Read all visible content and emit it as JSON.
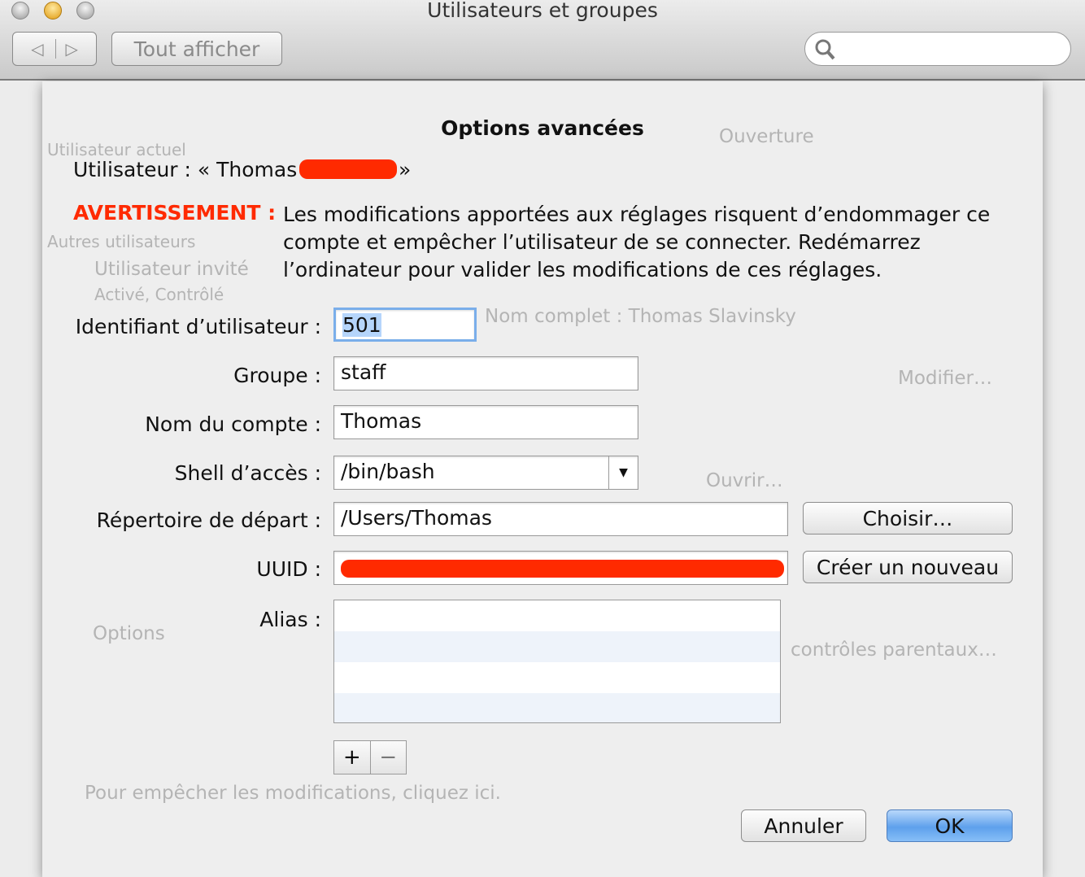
{
  "window": {
    "title": "Utilisateurs et groupes",
    "show_all": "Tout afficher",
    "back": "◁",
    "forward": "▷",
    "search_placeholder": ""
  },
  "background": {
    "current_user": "Utilisateur actuel",
    "other_users": "Autres utilisateurs",
    "guest": "Utilisateur invité",
    "guest_status": "Activé, Contrôlé",
    "options": "Options",
    "lock_text": "Pour empêcher les modifications, cliquez ici.",
    "tab_login": "Ouverture",
    "full_name": "Nom complet :  Thomas Slavinsky",
    "modify": "Modifier…",
    "open": "Ouvrir…",
    "parental": "contrôles parentaux…"
  },
  "dialog": {
    "title": "Options avancées",
    "user_line": "Utilisateur : « Thomas",
    "user_close": "»",
    "warning_label": "AVERTISSEMENT :",
    "warning_lines": [
      "Les modifications apportées aux réglages risquent d’endommager ce",
      "compte et empêcher l’utilisateur de se connecter. Redémarrez",
      "l’ordinateur pour valider les modifications de ces réglages."
    ],
    "fields": {
      "uid": {
        "label": "Identifiant d’utilisateur :",
        "value": "501"
      },
      "group": {
        "label": "Groupe :",
        "value": "staff"
      },
      "account": {
        "label": "Nom du compte :",
        "value": "Thomas"
      },
      "shell": {
        "label": "Shell d’accès :",
        "value": "/bin/bash"
      },
      "home": {
        "label": "Répertoire de départ :",
        "value": "/Users/Thomas"
      },
      "uuid": {
        "label": "UUID :",
        "value": ""
      },
      "alias": {
        "label": "Alias :"
      }
    },
    "choose": "Choisir…",
    "create_new": "Créer un nouveau",
    "add": "+",
    "remove": "−",
    "cancel": "Annuler",
    "ok": "OK"
  },
  "colors": {
    "warning": "#ff2a00",
    "accent": "#6aa6ea",
    "redaction": "#ff2a00"
  }
}
